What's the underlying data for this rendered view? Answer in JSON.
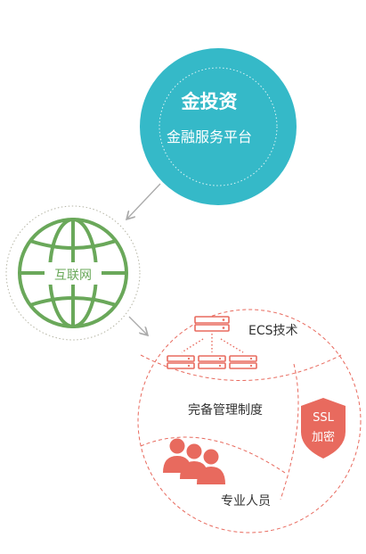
{
  "hero": {
    "title": "金投资",
    "subtitle": "金融服务平台",
    "color": "#35b9c8"
  },
  "internet": {
    "label": "互联网",
    "color": "#6aa85a"
  },
  "security": {
    "accent": "#e86a5e",
    "ecs_label": "ECS技术",
    "rules_label": "完备管理制度",
    "ssl_line1": "SSL",
    "ssl_line2": "加密",
    "staff_label": "专业人员"
  },
  "icons": [
    "globe-icon",
    "server-cluster-icon",
    "shield-icon",
    "people-icon",
    "arrow-icon"
  ]
}
